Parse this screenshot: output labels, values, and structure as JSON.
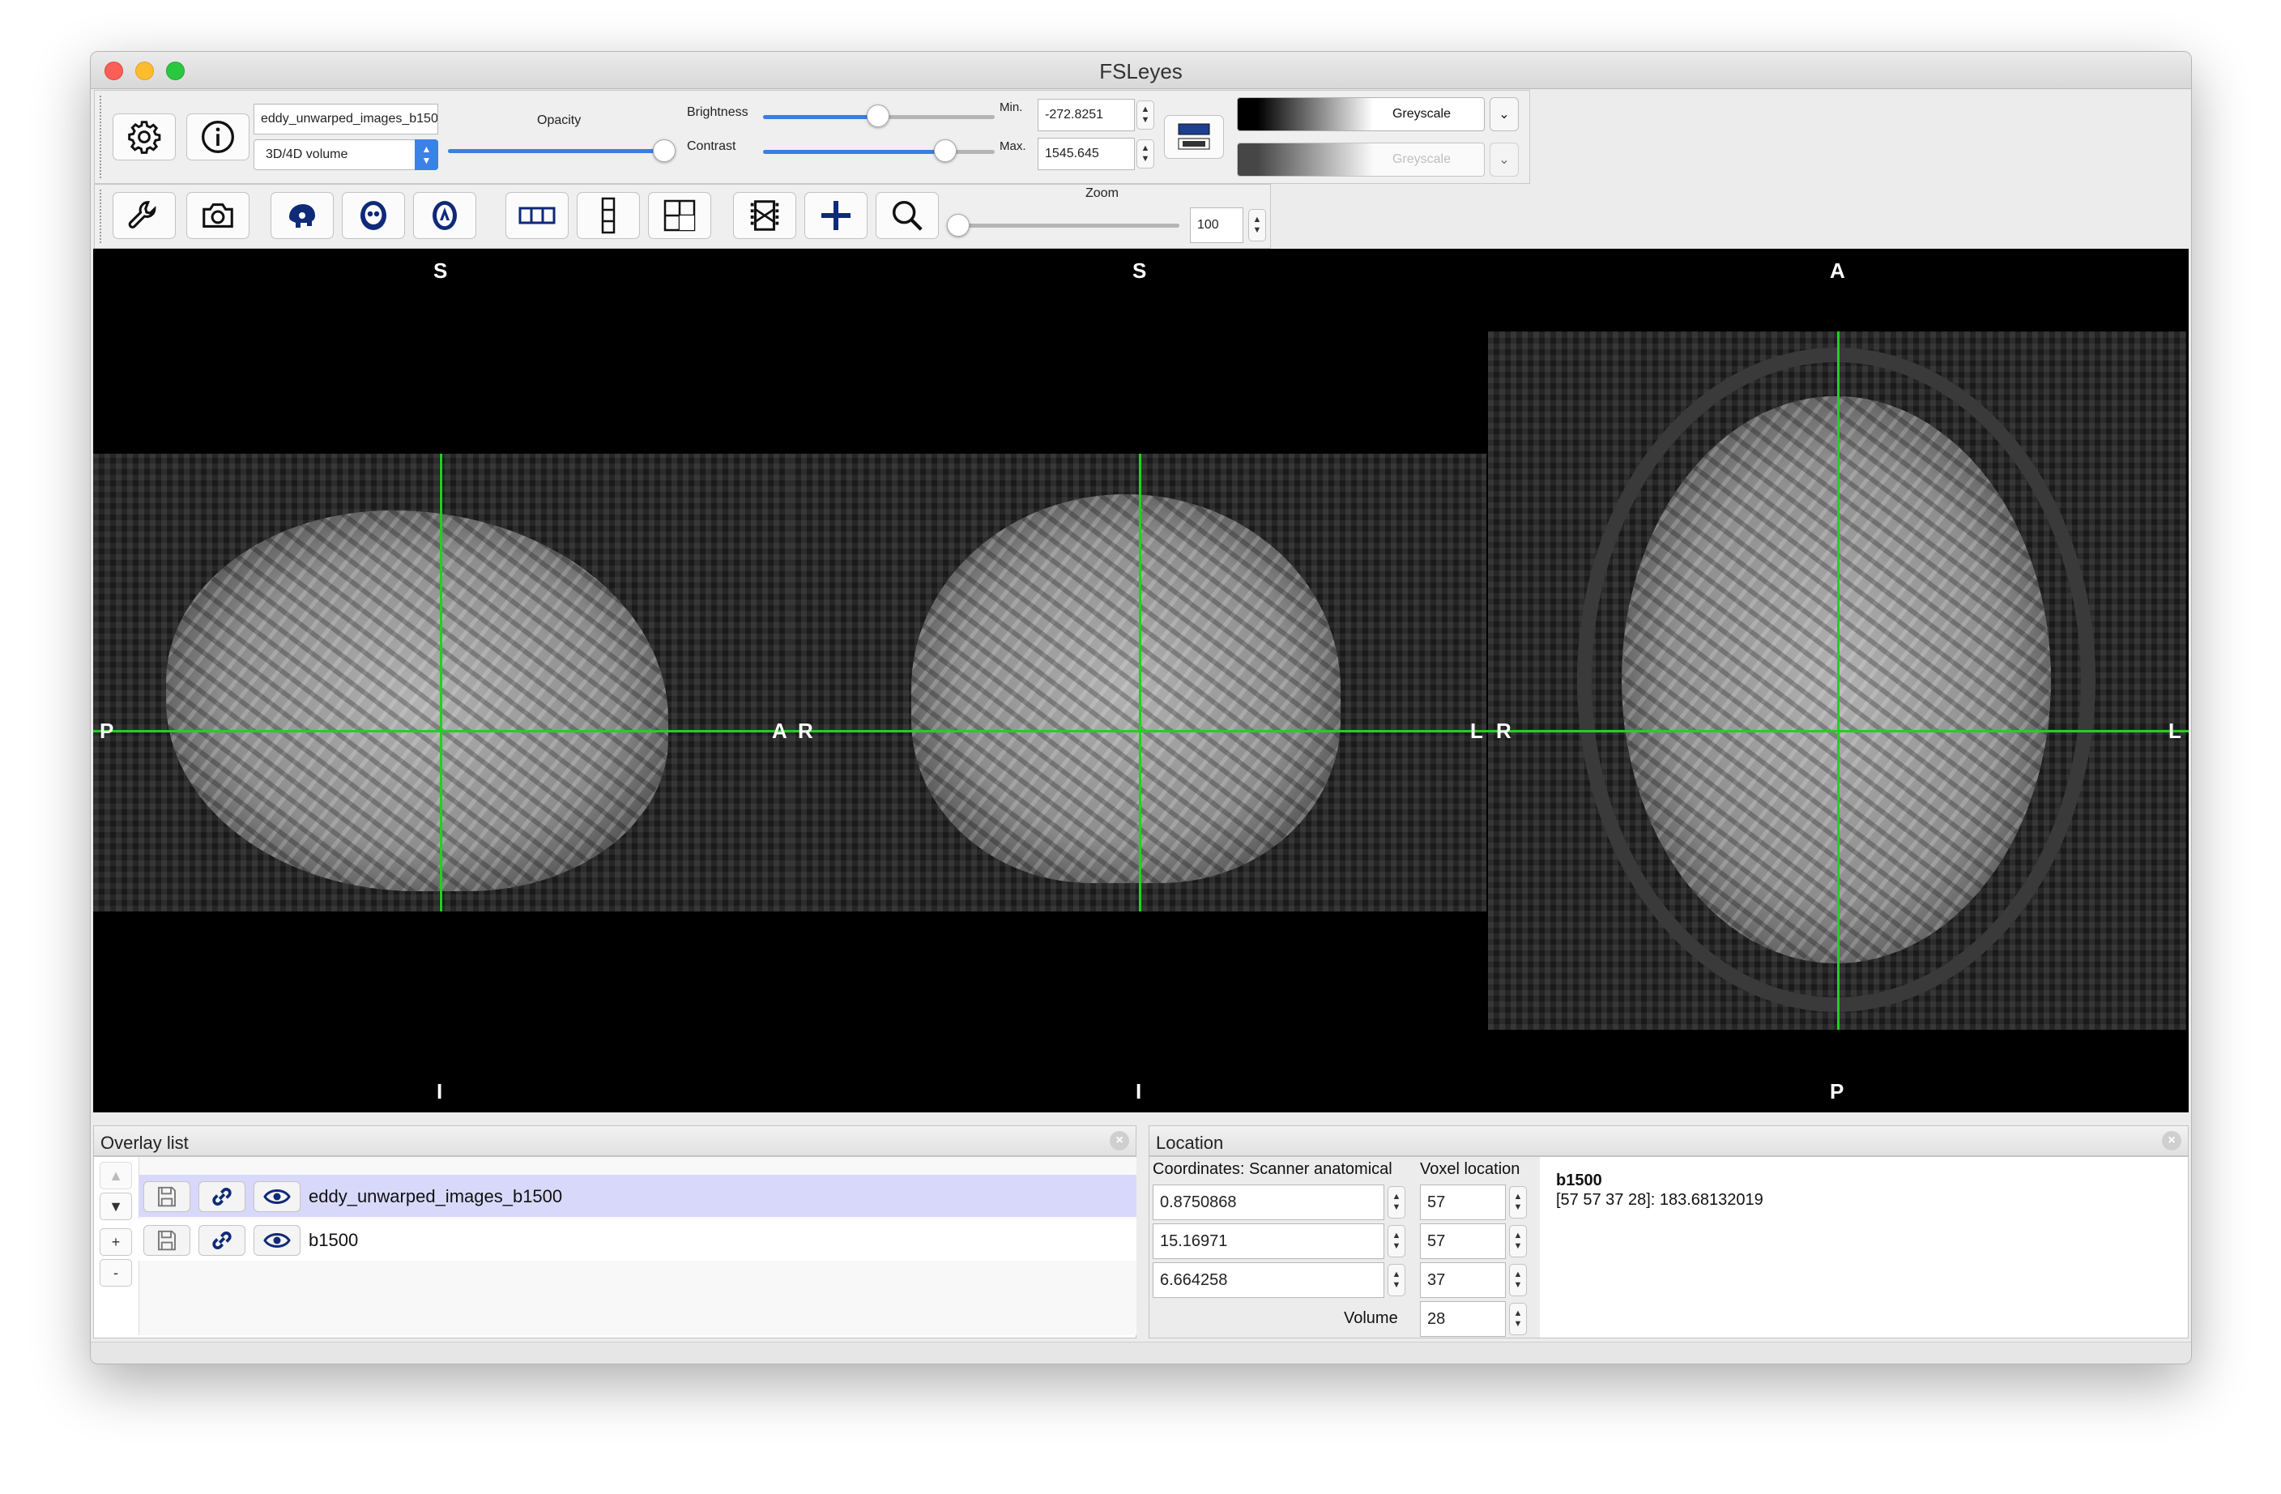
{
  "window": {
    "title": "FSLeyes"
  },
  "overlay_toolbar": {
    "overlay_name": "eddy_unwarped_images_b150",
    "overlay_type": "3D/4D volume",
    "opacity_label": "Opacity",
    "opacity": 1.0,
    "brightness_label": "Brightness",
    "brightness": 0.5,
    "contrast_label": "Contrast",
    "contrast": 0.8,
    "min_label": "Min.",
    "min_value": "-272.8251",
    "max_label": "Max.",
    "max_value": "1545.645",
    "cmap_primary": "Greyscale",
    "cmap_secondary": "Greyscale"
  },
  "view_toolbar": {
    "zoom_label": "Zoom",
    "zoom_value": "100",
    "zoom": 0.0
  },
  "views": {
    "sagittal": {
      "top": "S",
      "bottom": "I",
      "left": "P",
      "right": "A"
    },
    "coronal": {
      "top": "S",
      "bottom": "I",
      "left": "R",
      "right": "L"
    },
    "axial": {
      "top": "A",
      "bottom": "P",
      "left": "R",
      "right": "L"
    }
  },
  "overlay_list": {
    "title": "Overlay list",
    "up_label": "▲",
    "down_label": "▼",
    "add_label": "+",
    "remove_label": "-",
    "items": [
      {
        "name": "eddy_unwarped_images_b1500",
        "selected": true
      },
      {
        "name": "b1500",
        "selected": false
      }
    ]
  },
  "location": {
    "title": "Location",
    "coords_header": "Coordinates: Scanner anatomical",
    "voxel_header": "Voxel location",
    "coords": [
      "0.8750868",
      "15.16971",
      "6.664258"
    ],
    "voxels": [
      "57",
      "57",
      "37"
    ],
    "volume_label": "Volume",
    "volume_value": "28",
    "info_name": "b1500",
    "info_value": "[57 57 37 28]: 183.68132019"
  },
  "colors": {
    "crosshair": "#1ed21e",
    "selected_row": "#d8d8fb",
    "slider_fill": "#3c7ee0"
  }
}
